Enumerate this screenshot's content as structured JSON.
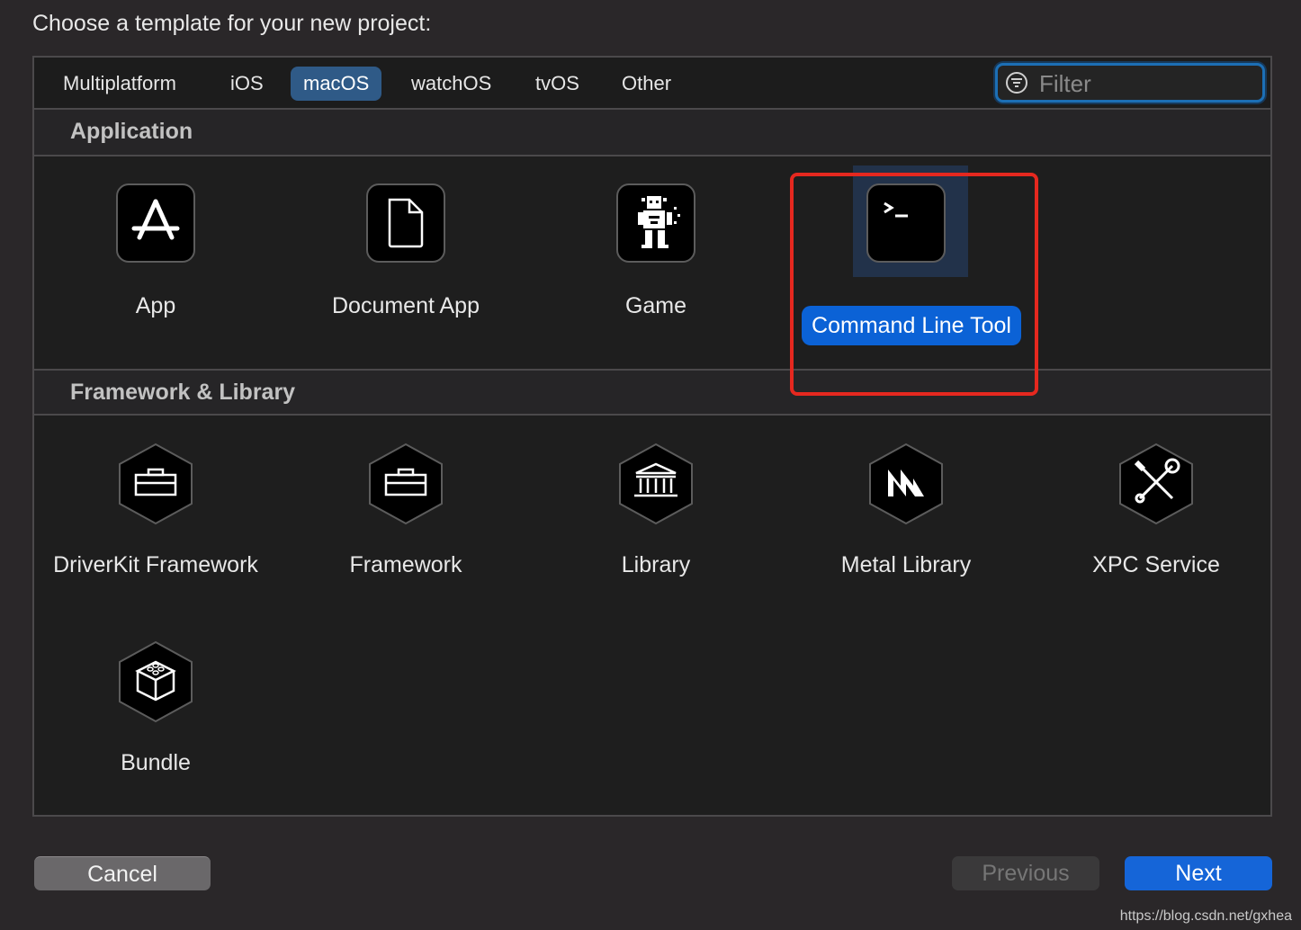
{
  "dialog": {
    "title": "Choose a template for your new project:"
  },
  "tabs": [
    {
      "label": "Multiplatform",
      "active": false
    },
    {
      "label": "iOS",
      "active": false
    },
    {
      "label": "macOS",
      "active": true
    },
    {
      "label": "watchOS",
      "active": false
    },
    {
      "label": "tvOS",
      "active": false
    },
    {
      "label": "Other",
      "active": false
    }
  ],
  "filter": {
    "placeholder": "Filter",
    "value": ""
  },
  "sections": [
    {
      "title": "Application",
      "templates": [
        {
          "label": "App",
          "icon": "app-store-icon"
        },
        {
          "label": "Document App",
          "icon": "document-icon"
        },
        {
          "label": "Game",
          "icon": "game-sprite-icon"
        },
        {
          "label": "Command Line Tool",
          "icon": "terminal-icon",
          "selected": true
        }
      ]
    },
    {
      "title": "Framework & Library",
      "templates": [
        {
          "label": "DriverKit Framework",
          "icon": "toolbox-icon"
        },
        {
          "label": "Framework",
          "icon": "toolbox-icon"
        },
        {
          "label": "Library",
          "icon": "library-building-icon"
        },
        {
          "label": "Metal Library",
          "icon": "metal-icon"
        },
        {
          "label": "XPC Service",
          "icon": "wrench-screwdriver-icon"
        },
        {
          "label": "Bundle",
          "icon": "lego-cube-icon"
        }
      ]
    }
  ],
  "buttons": {
    "cancel": "Cancel",
    "previous": "Previous",
    "next": "Next"
  },
  "colors": {
    "accent": "#1565d8",
    "highlight_annotation": "#e5281f",
    "selected_tab": "#2f5a87"
  },
  "watermark": "https://blog.csdn.net/gxhea"
}
